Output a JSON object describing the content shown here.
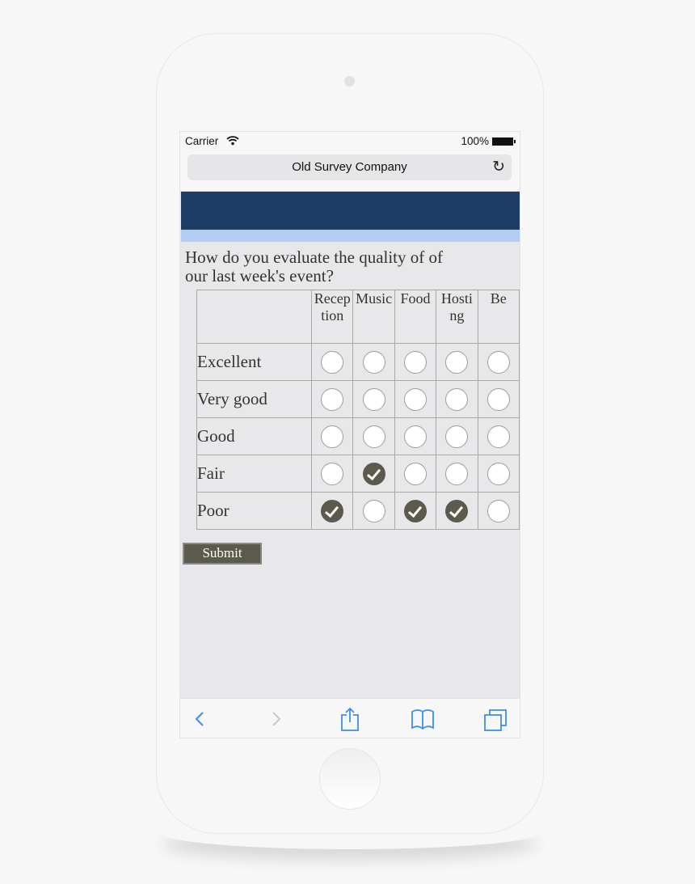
{
  "status_bar": {
    "carrier": "Carrier",
    "battery_percent": "100%"
  },
  "address_bar": {
    "title": "Old Survey Company"
  },
  "survey": {
    "question": "How do you evaluate the quality of of our last week's event?",
    "columns": [
      "Reception",
      "Music",
      "Food",
      "Hosting",
      "Be"
    ],
    "column_display": [
      "Recep tion",
      "Music",
      "Food",
      "Hosti ng",
      "Be"
    ],
    "rows": [
      "Excellent",
      "Very good",
      "Good",
      "Fair",
      "Poor"
    ],
    "selections": {
      "Reception": "Poor",
      "Music": "Fair",
      "Food": "Poor",
      "Hosting": "Poor"
    },
    "submit_label": "Submit"
  },
  "toolbar": {
    "icons": [
      "back-icon",
      "forward-icon",
      "share-icon",
      "bookmarks-icon",
      "tabs-icon"
    ]
  },
  "colors": {
    "header_dark": "#1d3c66",
    "header_light": "#b3cdf2",
    "checked_radio": "#5b5a4d",
    "ios_blue": "#3d8ee8"
  }
}
